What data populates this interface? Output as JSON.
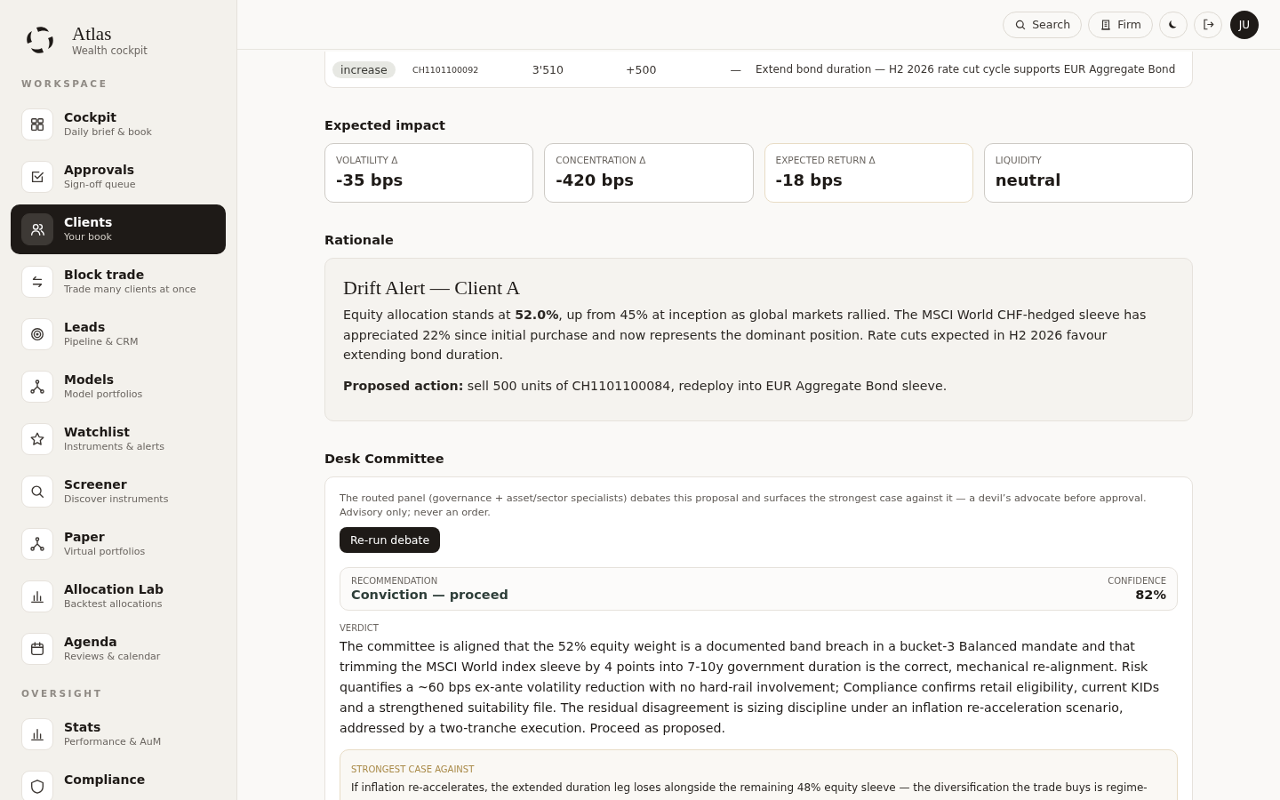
{
  "brand": {
    "name": "Atlas",
    "tagline": "Wealth cockpit"
  },
  "sidebar": {
    "sections": [
      {
        "title": "WORKSPACE",
        "items": [
          {
            "label": "Cockpit",
            "sub": "Daily brief & book",
            "selected": false
          },
          {
            "label": "Approvals",
            "sub": "Sign-off queue",
            "selected": false
          },
          {
            "label": "Clients",
            "sub": "Your book",
            "selected": true
          },
          {
            "label": "Block trade",
            "sub": "Trade many clients at once",
            "selected": false
          },
          {
            "label": "Leads",
            "sub": "Pipeline & CRM",
            "selected": false
          },
          {
            "label": "Models",
            "sub": "Model portfolios",
            "selected": false
          },
          {
            "label": "Watchlist",
            "sub": "Instruments & alerts",
            "selected": false
          },
          {
            "label": "Screener",
            "sub": "Discover instruments",
            "selected": false
          },
          {
            "label": "Paper",
            "sub": "Virtual portfolios",
            "selected": false
          },
          {
            "label": "Allocation Lab",
            "sub": "Backtest allocations",
            "selected": false
          },
          {
            "label": "Agenda",
            "sub": "Reviews & calendar",
            "selected": false
          }
        ]
      },
      {
        "title": "OVERSIGHT",
        "items": [
          {
            "label": "Stats",
            "sub": "Performance & AuM",
            "selected": false
          },
          {
            "label": "Compliance",
            "selected": false
          }
        ]
      }
    ]
  },
  "header": {
    "search": "Search",
    "firm": "Firm",
    "avatar": "JU"
  },
  "trade_table": {
    "rows": [
      {
        "action": "increase",
        "isin": "CH1101100092",
        "quantity": "3'510",
        "change": "+500",
        "column_5": "—",
        "note": "Extend bond duration — H2 2026 rate cut cycle supports EUR Aggregate Bond"
      }
    ]
  },
  "impact": {
    "title": "Expected impact",
    "cards": [
      {
        "label": "VOLATILITY Δ",
        "value": "-35 bps",
        "highlighted": false
      },
      {
        "label": "CONCENTRATION Δ",
        "value": "-420 bps",
        "highlighted": false
      },
      {
        "label": "EXPECTED RETURN Δ",
        "value": "-18 bps",
        "highlighted": true
      },
      {
        "label": "LIQUIDITY",
        "value": "neutral",
        "highlighted": false
      }
    ]
  },
  "rationale": {
    "title": "Rationale",
    "heading": "Drift Alert — Client A",
    "body": "Equity allocation stands at **52.0%**, up from 45% at inception as global markets rallied. The MSCI World CHF-hedged sleeve has appreciated 22% since initial purchase and now represents the dominant position. Rate cuts expected in H2 2026 favour extending bond duration.",
    "action": "**Proposed action:** sell 500 units of CH1101100084, redeploy into EUR Aggregate Bond sleeve."
  },
  "committee": {
    "title": "Desk Committee",
    "intro": "The routed panel (governance + asset/sector specialists) debates this proposal and surfaces the strongest case against it — a devil’s advocate before approval. Advisory only; never an order.",
    "button": "Re-run debate",
    "recommendation": {
      "label": "RECOMMENDATION",
      "value": "Conviction — proceed",
      "confidence_label": "CONFIDENCE",
      "confidence": "82%"
    },
    "verdict_label": "VERDICT",
    "verdict": "The committee is aligned that the 52% equity weight is a documented band breach in a bucket-3 Balanced mandate and that trimming the MSCI World index sleeve by 4 points into 7-10y government duration is the correct, mechanical re-alignment. Risk quantifies a ~60 bps ex-ante volatility reduction with no hard-rail involvement; Compliance confirms retail eligibility, current KIDs and a strengthened suitability file. The residual disagreement is sizing discipline under an inflation re-acceleration scenario, addressed by a two-tranche execution. Proceed as proposed.",
    "against_label": "STRONGEST CASE AGAINST",
    "against": "If inflation re-accelerates, the extended duration leg loses alongside the remaining 48% equity sleeve — the diversification the trade buys is regime-"
  }
}
